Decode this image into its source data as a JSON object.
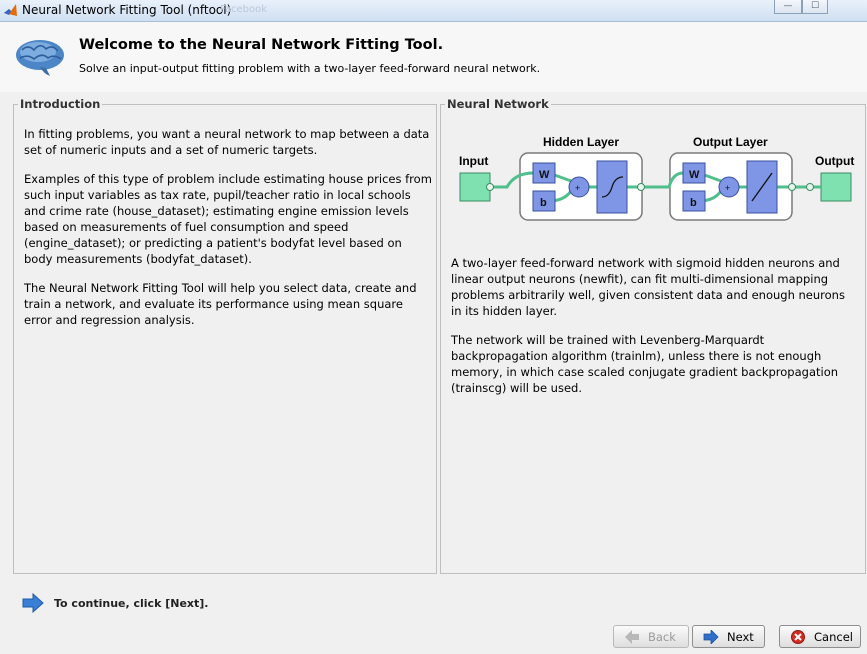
{
  "window": {
    "title": "Neural Network Fitting Tool (nftool)",
    "background_ghost": "Facebook",
    "controls": {
      "minimize": "—",
      "maximize": "☐"
    }
  },
  "header": {
    "title": "Welcome to the Neural Network Fitting Tool.",
    "subtitle": "Solve an input-output fitting problem with a two-layer feed-forward neural network."
  },
  "introduction": {
    "legend": "Introduction",
    "paragraphs": [
      "In fitting problems, you want a neural network to map between a data set of numeric inputs and a set of numeric targets.",
      "Examples of this type of problem include estimating house prices from such input variables as tax rate, pupil/teacher ratio in local schools and crime rate (house_dataset); estimating engine emission levels based on measurements of fuel consumption and speed (engine_dataset); or predicting a patient's bodyfat level based on body measurements (bodyfat_dataset).",
      "The Neural Network Fitting Tool will help you select data, create and train a network, and evaluate its performance using mean square error and regression analysis."
    ]
  },
  "neural_network": {
    "legend": "Neural Network",
    "diagram": {
      "input_label": "Input",
      "hidden_label": "Hidden Layer",
      "output_layer_label": "Output Layer",
      "output_label": "Output",
      "weight": "W",
      "bias": "b",
      "sum": "+"
    },
    "paragraphs": [
      "A two-layer feed-forward network with sigmoid hidden neurons and linear output neurons (newfit), can fit multi-dimensional mapping problems arbitrarily well, given consistent data and enough neurons in its hidden layer.",
      "The network will be trained with Levenberg-Marquardt backpropagation algorithm (trainlm), unless there is not enough memory, in which case scaled conjugate gradient backpropagation (trainscg) will be used."
    ]
  },
  "footer": {
    "hint": "To continue, click [Next].",
    "back_label": "Back",
    "next_label": "Next",
    "cancel_label": "Cancel"
  },
  "colors": {
    "accent_blue": "#3a7fd6",
    "node_green": "#7fe0b0",
    "box_blue": "#7f95e6",
    "cancel_red": "#d42b20"
  }
}
